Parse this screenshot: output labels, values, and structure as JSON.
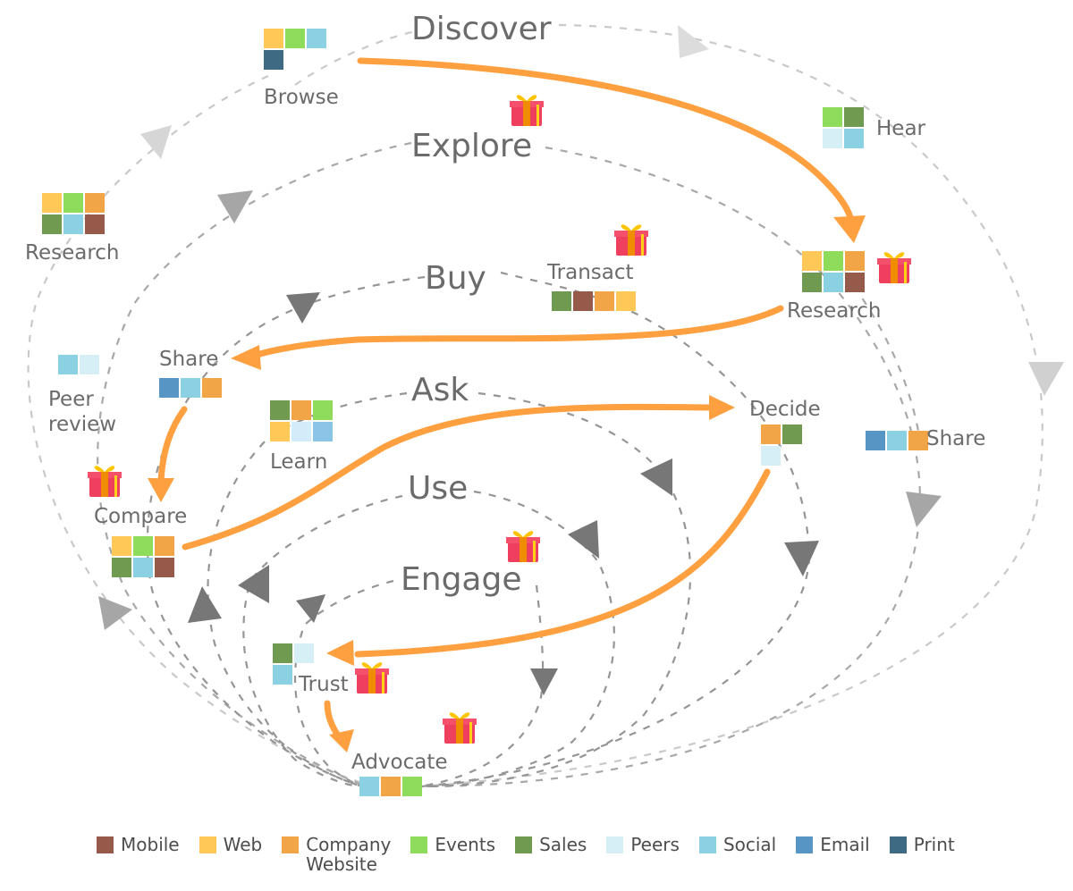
{
  "palette": {
    "Mobile": "#955a4a",
    "Web": "#ffc857",
    "Company Website": "#f2a546",
    "Events": "#8fdc5c",
    "Sales": "#6f9a4f",
    "Peers": "#d6eef5",
    "Social": "#8cd0e3",
    "Email": "#5796c4",
    "Print": "#3f6a83",
    "LearnPeers": "#d2ecfa",
    "LearnSocial": "#8ac4e6"
  },
  "accent": {
    "orange": "#ffa040",
    "dash_dark": "#8c8c8c",
    "dash_light": "#bdbdbd",
    "arrow_dark": "#777777",
    "arrow_mid": "#a6a6a6",
    "arrow_light": "#d8d8d8"
  },
  "stages": [
    {
      "id": "discover",
      "label": "Discover"
    },
    {
      "id": "explore",
      "label": "Explore"
    },
    {
      "id": "buy",
      "label": "Buy"
    },
    {
      "id": "ask",
      "label": "Ask"
    },
    {
      "id": "use",
      "label": "Use"
    },
    {
      "id": "engage",
      "label": "Engage"
    }
  ],
  "nodes": [
    {
      "id": "browse",
      "label": "Browse",
      "channels": [
        [
          "Web",
          "Events",
          "Social"
        ],
        [
          "Print"
        ]
      ],
      "gift": false
    },
    {
      "id": "hear",
      "label": "Hear",
      "channels": [
        [
          "Events",
          "Sales"
        ],
        [
          "Peers",
          "Social"
        ]
      ],
      "gift": false
    },
    {
      "id": "research-left",
      "label": "Research",
      "channels": [
        [
          "Web",
          "Events",
          "Company Website"
        ],
        [
          "Sales",
          "Social",
          "Mobile"
        ]
      ],
      "gift": false
    },
    {
      "id": "research-right",
      "label": "Research",
      "channels": [
        [
          "Web",
          "Events",
          "Company Website"
        ],
        [
          "Sales",
          "Social",
          "Mobile"
        ]
      ],
      "gift": true
    },
    {
      "id": "transact",
      "label": "Transact",
      "channels": [
        [
          "Sales",
          "Mobile",
          "Company Website",
          "Web"
        ]
      ],
      "gift": true
    },
    {
      "id": "peer-review",
      "label": "Peer\nreview",
      "channels": [
        [
          "Social",
          "Peers"
        ]
      ],
      "gift": false
    },
    {
      "id": "share-left",
      "label": "Share",
      "channels": [
        [
          "Email",
          "Social",
          "Company Website"
        ]
      ],
      "gift": false
    },
    {
      "id": "learn",
      "label": "Learn",
      "channels": [
        [
          "Sales",
          "Company Website",
          "Events"
        ],
        [
          "Web",
          "LearnPeers",
          "LearnSocial"
        ]
      ],
      "gift": false
    },
    {
      "id": "decide",
      "label": "Decide",
      "channels": [
        [
          "Company Website",
          "Sales"
        ],
        [
          "Peers"
        ]
      ],
      "gift": false
    },
    {
      "id": "share-right",
      "label": "Share",
      "channels": [
        [
          "Email",
          "Social",
          "Company Website"
        ]
      ],
      "gift": false
    },
    {
      "id": "compare",
      "label": "Compare",
      "channels": [
        [
          "Web",
          "Events",
          "Company Website"
        ],
        [
          "Sales",
          "Social",
          "Mobile"
        ]
      ],
      "gift": true
    },
    {
      "id": "trust",
      "label": "Trust",
      "channels": [
        [
          "Sales",
          "Peers"
        ],
        [
          "Social"
        ]
      ],
      "gift": true
    },
    {
      "id": "advocate",
      "label": "Advocate",
      "channels": [
        [
          "Social",
          "Company Website",
          "Events"
        ]
      ],
      "gift": true
    }
  ],
  "extra_gifts": [
    "explore",
    "engage"
  ],
  "legend": [
    {
      "label": "Mobile",
      "key": "Mobile"
    },
    {
      "label": "Web",
      "key": "Web"
    },
    {
      "label": "Company\nWebsite",
      "key": "Company Website"
    },
    {
      "label": "Events",
      "key": "Events"
    },
    {
      "label": "Sales",
      "key": "Sales"
    },
    {
      "label": "Peers",
      "key": "Peers"
    },
    {
      "label": "Social",
      "key": "Social"
    },
    {
      "label": "Email",
      "key": "Email"
    },
    {
      "label": "Print",
      "key": "Print"
    }
  ]
}
